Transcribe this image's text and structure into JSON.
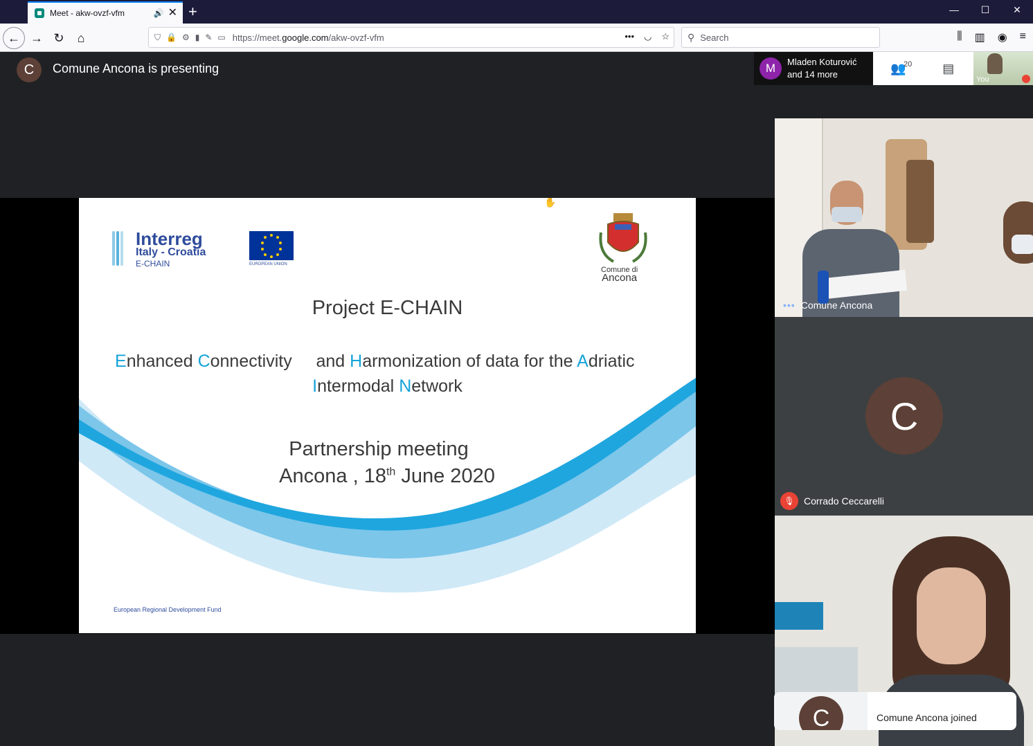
{
  "browser": {
    "tab_title": "Meet - akw-ovzf-vfm",
    "url_prefix": "https://meet.",
    "url_domain": "google.com",
    "url_path": "/akw-ovzf-vfm",
    "search_placeholder": "Search"
  },
  "meet": {
    "presenter_initial": "C",
    "presenter_text": "Comune Ancona is presenting",
    "participants_avatar_initial": "M",
    "participants_line1": "Mladen Koturović",
    "participants_line2": "and 14 more",
    "people_count": "20",
    "self_label": "You"
  },
  "slide": {
    "interreg": "Interreg",
    "interreg_sub": "Italy - Croatia",
    "interreg_project": "E-CHAIN",
    "eu_text": "EUROPEAN UNION",
    "coat_caption_1": "Comune di",
    "coat_caption_2": "Ancona",
    "title": "Project E-CHAIN",
    "line1": {
      "h1": "E",
      "t1": "nhanced ",
      "h2": "C",
      "t2": "onnectivity     and ",
      "h3": "H",
      "t3": "armonization of data for the ",
      "h4": "A",
      "t4": "driatic"
    },
    "line2": {
      "h1": "I",
      "t1": "ntermodal ",
      "h2": "N",
      "t2": "etwork"
    },
    "meeting": "Partnership meeting",
    "date_pre": "Ancona , 18",
    "date_sup": "th",
    "date_post": " June 2020",
    "fund": "European Regional Development Fund"
  },
  "tiles": [
    {
      "name": "Comune Ancona"
    },
    {
      "initial": "C",
      "name": "Corrado Ceccarelli"
    }
  ],
  "toast": {
    "initial": "C",
    "text": "Comune Ancona joined"
  },
  "colors": {
    "accent": "#15a3d8",
    "interreg_blue": "#2f4c9c",
    "mute_red": "#ea4335"
  }
}
